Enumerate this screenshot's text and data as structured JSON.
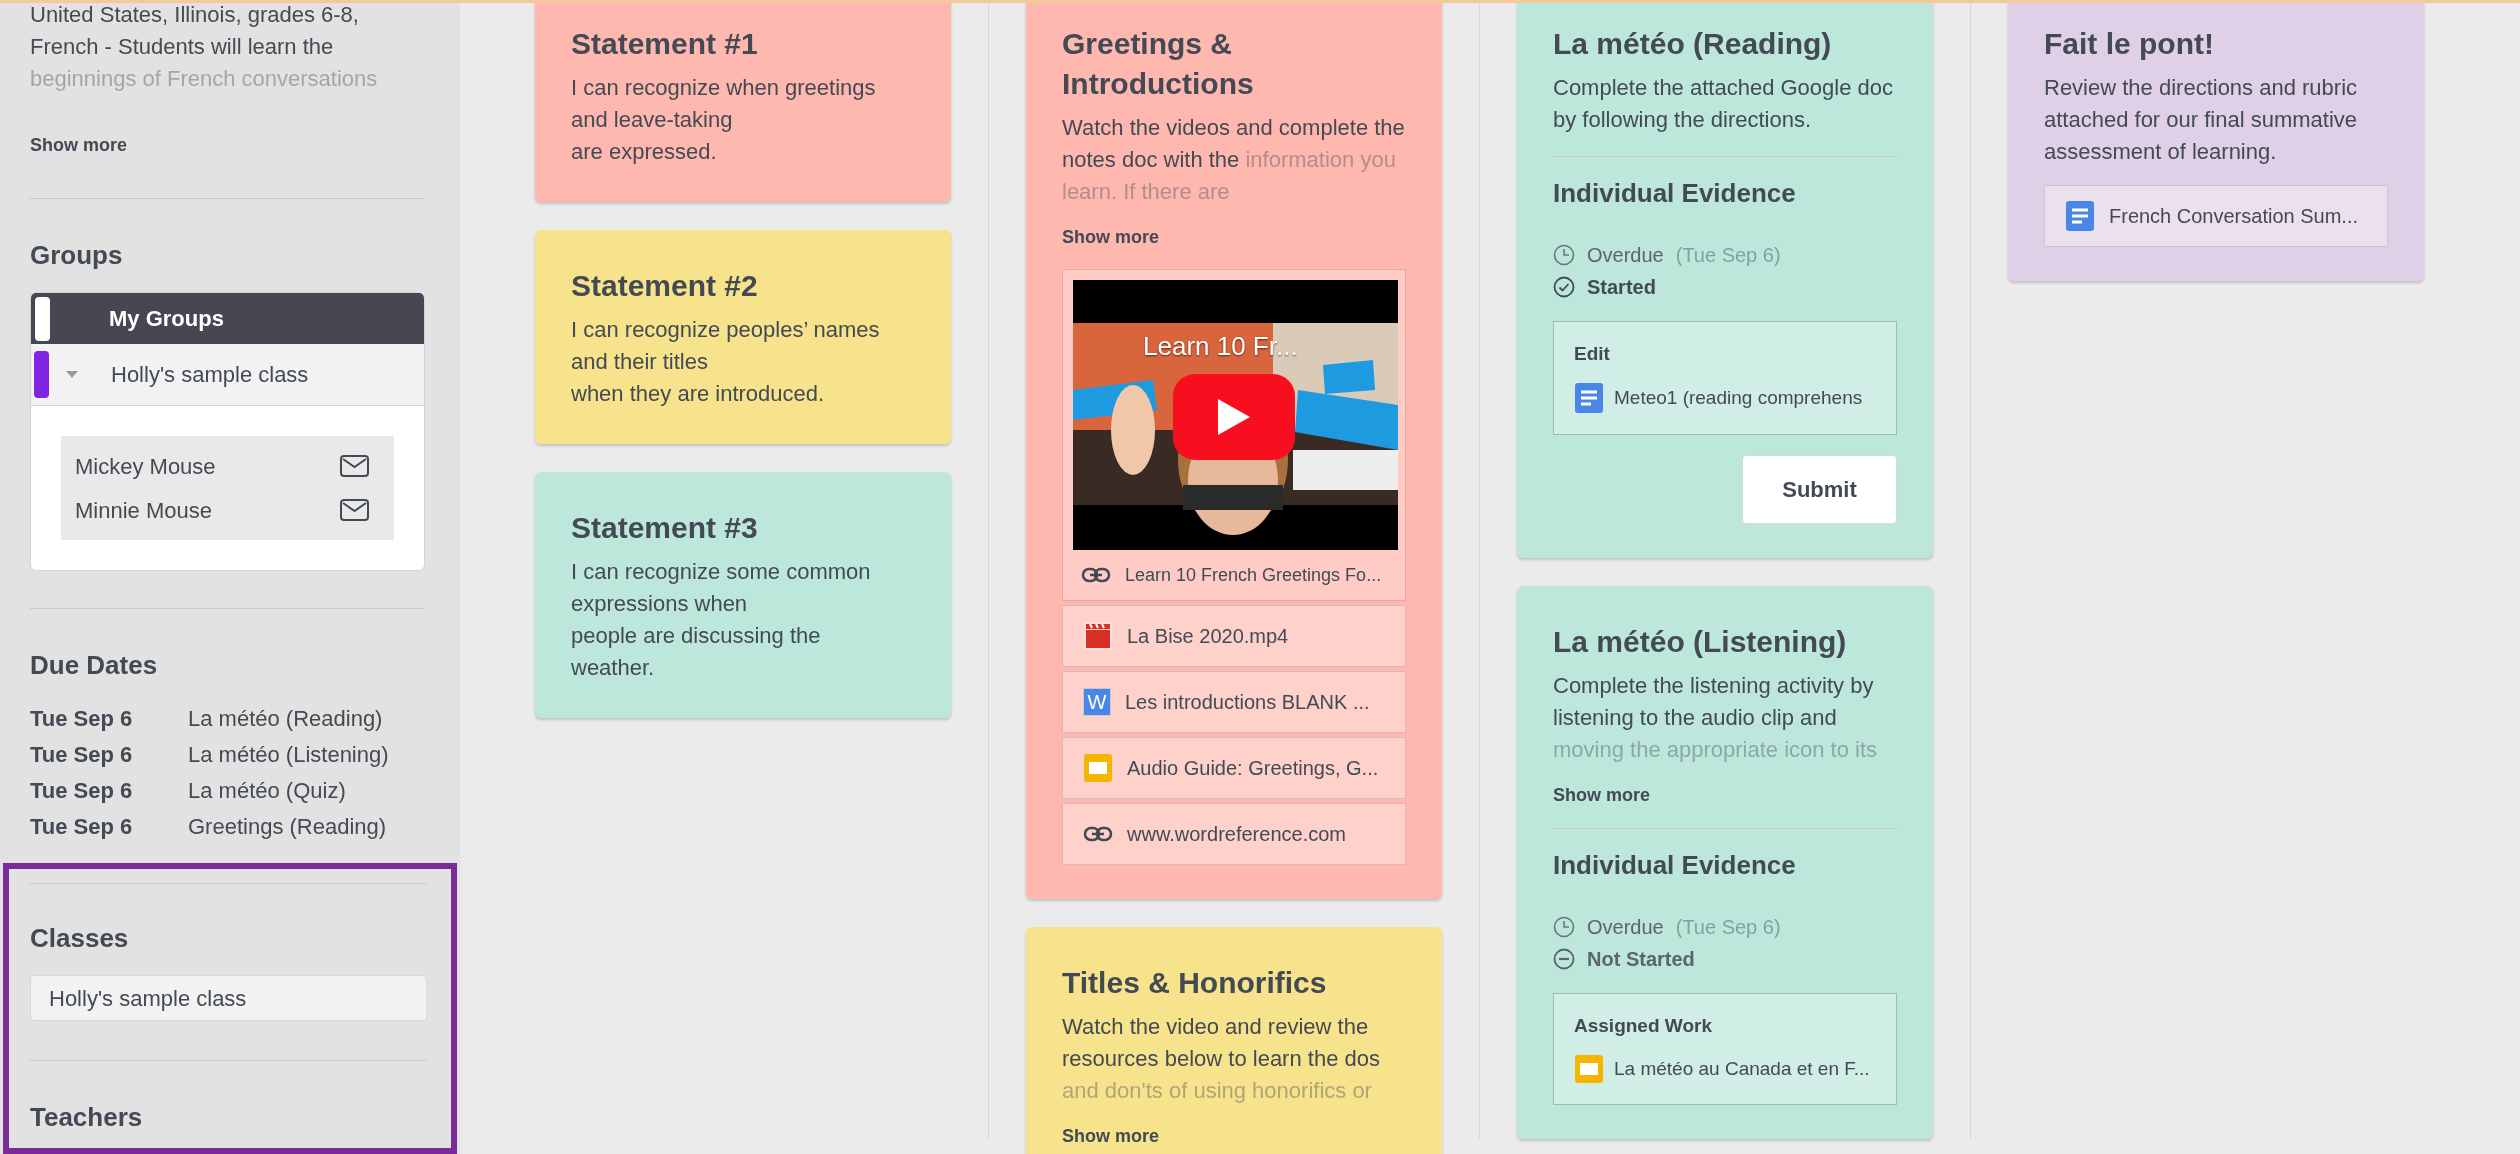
{
  "sidebar": {
    "description": "United States, Illinois, grades 6-8, French - Students will learn the",
    "description_faded": "beginnings of French conversations",
    "show_more": "Show more",
    "groups": {
      "title": "Groups",
      "header": "My Groups",
      "group": {
        "name": "Holly's sample class",
        "color": "#8224e3",
        "expanded": true,
        "members": [
          "Mickey Mouse",
          "Minnie Mouse"
        ]
      }
    },
    "due_dates": {
      "title": "Due Dates",
      "items": [
        {
          "date": "Tue Sep 6",
          "name": "La météo (Reading)"
        },
        {
          "date": "Tue Sep 6",
          "name": "La météo (Listening)"
        },
        {
          "date": "Tue Sep 6",
          "name": "La météo (Quiz)"
        },
        {
          "date": "Tue Sep 6",
          "name": "Greetings (Reading)"
        }
      ]
    },
    "classes": {
      "title": "Classes",
      "highlighted": true,
      "items": [
        "Holly's sample class"
      ]
    },
    "teachers": {
      "title": "Teachers"
    }
  },
  "columns": [
    {
      "cards": [
        {
          "title": "Statement #1",
          "color": "#feb8b0",
          "description": "I can recognize when greetings\nand leave-taking\nare expressed."
        },
        {
          "title": "Statement #2",
          "color": "#f6e38c",
          "description": "I can recognize peoples’ names\nand their titles\nwhen they are introduced."
        },
        {
          "title": "Statement #3",
          "color": "#bde7db",
          "description": "I can recognize some common\nexpressions when\npeople are discussing the\nweather."
        }
      ]
    },
    {
      "cards": [
        {
          "title": "Greetings & Introductions",
          "color": "#feb8b0",
          "description": "Watch the videos and complete the notes doc with the",
          "description_faded": "information you learn. If there are",
          "show_more": "Show more",
          "video": {
            "title": "Learn 10 Fr...",
            "link": "Learn 10 French Greetings Fo..."
          },
          "attachments": [
            {
              "kind": "video",
              "label": "La Bise 2020.mp4"
            },
            {
              "kind": "word",
              "icon_text": "W",
              "label": "Les introductions BLANK ..."
            },
            {
              "kind": "slides",
              "label": "Audio Guide: Greetings, G..."
            },
            {
              "kind": "link",
              "label": "www.wordreference.com"
            }
          ]
        },
        {
          "title": "Titles & Honorifics",
          "color": "#f6e38c",
          "description": "Watch the video and review the resources below to learn the dos",
          "description_faded": "and don'ts of using honorifics or",
          "show_more": "Show more"
        }
      ]
    },
    {
      "cards": [
        {
          "title": "La météo (Reading)",
          "color": "#bde7db",
          "description": "Complete the attached Google doc by following the directions.",
          "evidence": {
            "heading": "Individual Evidence",
            "due_status": "Overdue",
            "due_date": "(Tue Sep 6)",
            "status": "Started",
            "kind": "started",
            "box_title": "Edit",
            "file": {
              "kind": "doc",
              "label": "Meteo1 (reading comprehens"
            },
            "button": "Submit"
          }
        },
        {
          "title": "La météo (Listening)",
          "color": "#bde7db",
          "description": "Complete the listening activity by listening to the audio clip and",
          "description_faded": "moving the appropriate icon to its",
          "show_more": "Show more",
          "evidence": {
            "heading": "Individual Evidence",
            "due_status": "Overdue",
            "due_date": "(Tue Sep 6)",
            "status": "Not Started",
            "kind": "not_started",
            "box_title": "Assigned Work",
            "file": {
              "kind": "slides",
              "label": "La météo au Canada et en F..."
            }
          }
        }
      ]
    },
    {
      "cards": [
        {
          "title": "Fait le pont!",
          "color": "#dfd0e8",
          "description": "Review the directions and rubric attached for our final summative assessment of learning.",
          "attachments": [
            {
              "kind": "doc",
              "label": "French Conversation Sum..."
            }
          ]
        }
      ]
    }
  ]
}
